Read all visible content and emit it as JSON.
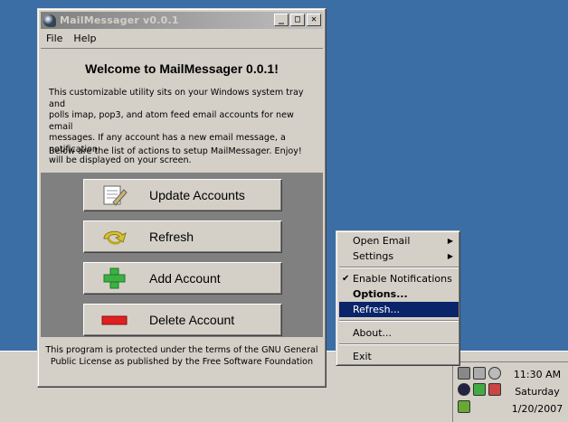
{
  "window": {
    "title": "MailMessager v0.0.1",
    "minimize_glyph": "_",
    "maximize_glyph": "□",
    "close_glyph": "✕"
  },
  "menubar": {
    "file": "File",
    "help": "Help"
  },
  "welcome": "Welcome to MailMessager 0.0.1!",
  "description": "This customizable utility sits on your Windows system tray and\npolls imap, pop3, and atom feed email accounts for new email\nmessages. If any account has a new email message, a notification\nwill be displayed on your screen.",
  "instructions": "Below are the list of actions to setup MailMessager. Enjoy!",
  "actions": [
    {
      "label": "Update Accounts",
      "icon": "notepad-pencil-icon"
    },
    {
      "label": "Refresh",
      "icon": "refresh-arrow-icon"
    },
    {
      "label": "Add Account",
      "icon": "green-plus-icon"
    },
    {
      "label": "Delete Account",
      "icon": "red-minus-icon"
    }
  ],
  "license": "This program is protected under the terms of the GNU General\nPublic License as published by the Free Software Foundation",
  "context_menu": {
    "open_email": "Open Email",
    "settings": "Settings",
    "enable_notifications": "Enable Notifications",
    "options": "Options...",
    "refresh": "Refresh...",
    "about": "About...",
    "exit": "Exit",
    "check_glyph": "✔",
    "submenu_glyph": "▶"
  },
  "tray": {
    "time": "11:30 AM",
    "day": "Saturday",
    "date": "1/20/2007"
  },
  "colors": {
    "desktop": "#3a6ea5",
    "highlight": "#0a246a",
    "window_face": "#d4d0c8"
  }
}
